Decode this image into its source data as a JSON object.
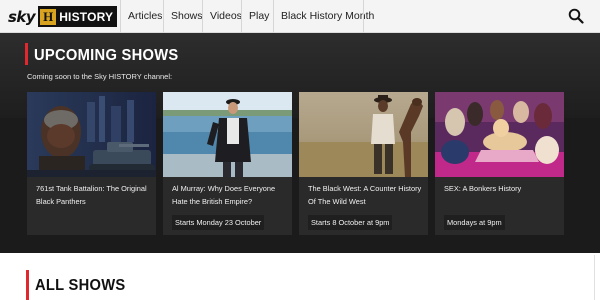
{
  "header": {
    "logo": {
      "sky": "sky",
      "h": "H",
      "history": "HISTORY"
    },
    "nav": [
      "Articles",
      "Shows",
      "Videos",
      "Play",
      "Black History Month"
    ],
    "search_icon": "search-icon"
  },
  "upcoming": {
    "title": "UPCOMING SHOWS",
    "subtitle": "Coming soon to the Sky HISTORY channel:",
    "cards": [
      {
        "title": "761st Tank Battalion: The Original Black Panthers",
        "badge": ""
      },
      {
        "title": "Al Murray: Why Does Everyone Hate the British Empire?",
        "badge": "Starts Monday 23 October"
      },
      {
        "title": "The Black West: A Counter History Of The Wild West",
        "badge": "Starts 8 October at 9pm"
      },
      {
        "title": "SEX: A Bonkers History",
        "badge": "Mondays at 9pm"
      }
    ]
  },
  "all_shows": {
    "title": "ALL SHOWS"
  },
  "colors": {
    "accent": "#e0282e",
    "dark_bg": "#1b1b1b",
    "card_bg": "#2a2a2a",
    "logo_gold": "#d9a521"
  }
}
